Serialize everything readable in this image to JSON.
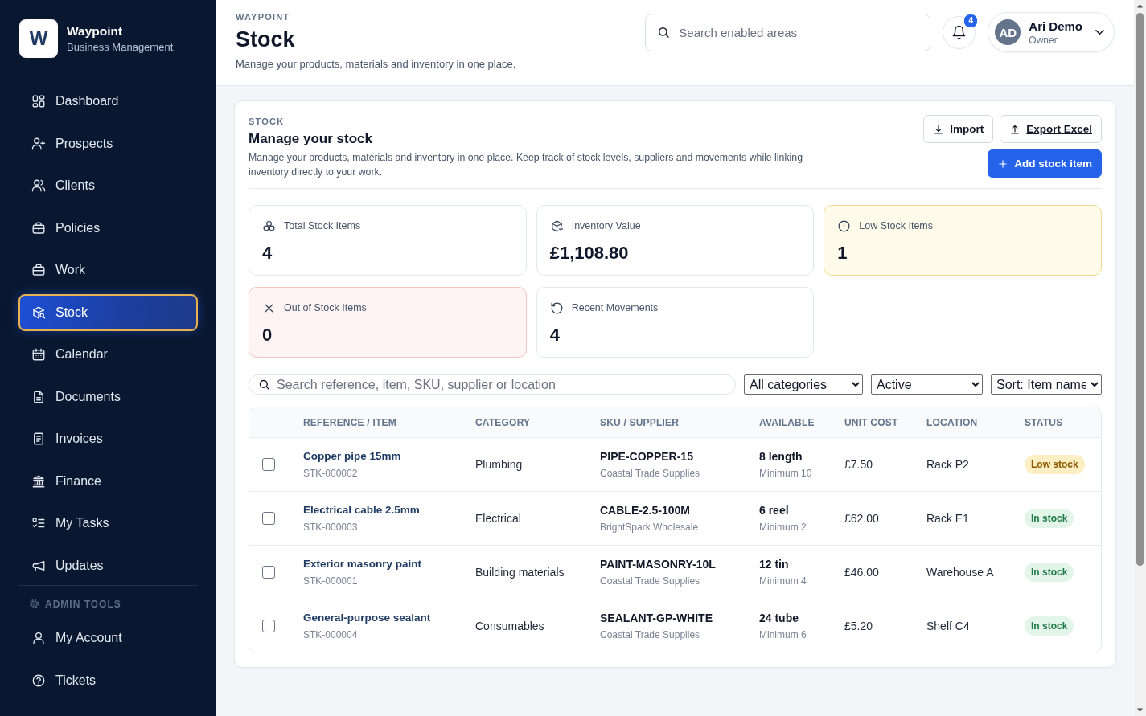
{
  "sidebar": {
    "brand": {
      "mark": "W",
      "name": "Waypoint",
      "tagline": "Business Management"
    },
    "items": [
      {
        "label": "Dashboard",
        "selected": false
      },
      {
        "label": "Prospects",
        "selected": false
      },
      {
        "label": "Clients",
        "selected": false
      },
      {
        "label": "Policies",
        "selected": false
      },
      {
        "label": "Work",
        "selected": false
      },
      {
        "label": "Stock",
        "selected": true
      },
      {
        "label": "Calendar",
        "selected": false
      },
      {
        "label": "Documents",
        "selected": false
      },
      {
        "label": "Invoices",
        "selected": false
      },
      {
        "label": "Finance",
        "selected": false
      },
      {
        "label": "My Tasks",
        "selected": false
      },
      {
        "label": "Updates",
        "selected": false
      }
    ],
    "admin": {
      "heading": "ADMIN TOOLS",
      "items": [
        {
          "label": "My Account",
          "selected": false
        },
        {
          "label": "Tickets",
          "selected": false
        }
      ]
    }
  },
  "header": {
    "eyebrow": "WAYPOINT",
    "title": "Stock",
    "subtitle": "Manage your products, materials and inventory in one place.",
    "search": {
      "placeholder": "Search enabled areas"
    },
    "notifications": {
      "count": "4"
    },
    "user": {
      "initials": "AD",
      "name": "Ari Demo",
      "role": "Owner"
    }
  },
  "panel": {
    "eyebrow": "STOCK",
    "title": "Manage your stock",
    "description": "Manage your products, materials and inventory in one place. Keep track of stock levels, suppliers and movements while linking inventory directly to your work.",
    "actions": [
      {
        "label": "Import",
        "kind": "import"
      },
      {
        "label": "Export Excel",
        "kind": "export"
      },
      {
        "label": "Add stock item",
        "kind": "add"
      }
    ],
    "stats": [
      {
        "label": "Total Stock Items",
        "value": "4",
        "kind": "total"
      },
      {
        "label": "Inventory Value",
        "value": "£1,108.80",
        "kind": "value"
      },
      {
        "label": "Low Stock Items",
        "value": "1",
        "kind": "low"
      },
      {
        "label": "Out of Stock Items",
        "value": "0",
        "kind": "out"
      },
      {
        "label": "Recent Movements",
        "value": "4",
        "kind": "movements"
      }
    ],
    "filters": {
      "search": {
        "placeholder": "Search reference, item, SKU, supplier or location"
      },
      "selects": [
        {
          "value": "All categories"
        },
        {
          "value": "Active"
        },
        {
          "value": "Sort: Item name"
        }
      ]
    },
    "table": {
      "columns": [
        "REFERENCE / ITEM",
        "CATEGORY",
        "SKU / SUPPLIER",
        "AVAILABLE",
        "UNIT COST",
        "LOCATION",
        "STATUS"
      ],
      "rows": [
        {
          "checked": false,
          "item": "Copper pipe 15mm",
          "reference": "STK-000002",
          "category": "Plumbing",
          "sku": "PIPE-COPPER-15",
          "supplier": "Coastal Trade Supplies",
          "available": "8 length",
          "minimum": "Minimum 10",
          "unit_cost": "£7.50",
          "location": "Rack P2",
          "status": {
            "label": "Low stock",
            "kind": "low"
          }
        },
        {
          "checked": false,
          "item": "Electrical cable 2.5mm",
          "reference": "STK-000003",
          "category": "Electrical",
          "sku": "CABLE-2.5-100M",
          "supplier": "BrightSpark Wholesale",
          "available": "6 reel",
          "minimum": "Minimum 2",
          "unit_cost": "£62.00",
          "location": "Rack E1",
          "status": {
            "label": "In stock",
            "kind": "ok"
          }
        },
        {
          "checked": false,
          "item": "Exterior masonry paint",
          "reference": "STK-000001",
          "category": "Building materials",
          "sku": "PAINT-MASONRY-10L",
          "supplier": "Coastal Trade Supplies",
          "available": "12 tin",
          "minimum": "Minimum 4",
          "unit_cost": "£46.00",
          "location": "Warehouse A",
          "status": {
            "label": "In stock",
            "kind": "ok"
          }
        },
        {
          "checked": false,
          "item": "General-purpose sealant",
          "reference": "STK-000004",
          "category": "Consumables",
          "sku": "SEALANT-GP-WHITE",
          "supplier": "Coastal Trade Supplies",
          "available": "24 tube",
          "minimum": "Minimum 6",
          "unit_cost": "£5.20",
          "location": "Shelf C4",
          "status": {
            "label": "In stock",
            "kind": "ok"
          }
        }
      ]
    }
  }
}
